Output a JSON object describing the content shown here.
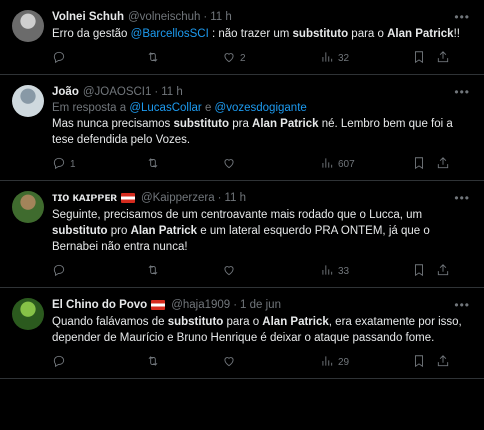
{
  "tweets": [
    {
      "name": "Volnei Schuh",
      "handle": "@volneischuh",
      "dot": "·",
      "time": "11 h",
      "flag": false,
      "reply_to": null,
      "segments": [
        {
          "t": "Erro da gestão ",
          "s": "n"
        },
        {
          "t": "@BarcellosSCI",
          "s": "l"
        },
        {
          "t": " : não trazer um ",
          "s": "n"
        },
        {
          "t": "substituto",
          "s": "b"
        },
        {
          "t": " para o ",
          "s": "n"
        },
        {
          "t": "Alan Patrick",
          "s": "b"
        },
        {
          "t": "!!",
          "s": "n"
        }
      ],
      "replies": "",
      "retweets": "",
      "likes": "2",
      "views": "32",
      "avatar_colors": [
        "#6b6b6b",
        "#cfcfcf"
      ]
    },
    {
      "name": "João",
      "handle": "@JOAOSCI1",
      "dot": "·",
      "time": "11 h",
      "flag": false,
      "reply_to": {
        "prefix": "Em resposta a ",
        "user1": "@LucasCollar",
        "joiner": " e ",
        "user2": "@vozesdogigante"
      },
      "segments": [
        {
          "t": "Mas nunca precisamos ",
          "s": "n"
        },
        {
          "t": "substituto",
          "s": "b"
        },
        {
          "t": " pra ",
          "s": "n"
        },
        {
          "t": "Alan Patrick",
          "s": "b"
        },
        {
          "t": " né. Lembro bem que foi a tese defendida pelo Vozes.",
          "s": "n"
        }
      ],
      "replies": "1",
      "retweets": "",
      "likes": "",
      "views": "607",
      "avatar_colors": [
        "#cfd9de",
        "#8899a6"
      ]
    },
    {
      "name": "ᴛɪᴏ ᴋᴀɪᴘᴘᴇʀ",
      "handle": "@Kaipperzera",
      "dot": "·",
      "time": "11 h",
      "flag": true,
      "reply_to": null,
      "segments": [
        {
          "t": "Seguinte, precisamos de um centroavante mais rodado que o Lucca, um ",
          "s": "n"
        },
        {
          "t": "substituto",
          "s": "b"
        },
        {
          "t": " pro ",
          "s": "n"
        },
        {
          "t": "Alan Patrick",
          "s": "b"
        },
        {
          "t": " e um lateral esquerdo PRA ONTEM, já que o Bernabei não entra nunca!",
          "s": "n"
        }
      ],
      "replies": "",
      "retweets": "",
      "likes": "",
      "views": "33",
      "avatar_colors": [
        "#3f6b2e",
        "#a3845a"
      ]
    },
    {
      "name": "El Chino do Povo",
      "handle": "@haja1909",
      "dot": "·",
      "time": "1 de jun",
      "flag": true,
      "reply_to": null,
      "segments": [
        {
          "t": "Quando falávamos de ",
          "s": "n"
        },
        {
          "t": "substituto",
          "s": "b"
        },
        {
          "t": " para o ",
          "s": "n"
        },
        {
          "t": "Alan Patrick",
          "s": "b"
        },
        {
          "t": ", era exatamente por isso, depender de Maurício e Bruno Henrique é deixar o ataque passando fome.",
          "s": "n"
        }
      ],
      "replies": "",
      "retweets": "",
      "likes": "",
      "views": "29",
      "avatar_colors": [
        "#2b5a1e",
        "#86c247"
      ]
    }
  ],
  "colors": {
    "background": "#000000",
    "text": "#e7e9ea",
    "muted": "#71767b",
    "link": "#1d9bf0",
    "border": "#2f3336"
  },
  "icons": {
    "more": "more-dots-icon",
    "reply": "reply-icon",
    "retweet": "retweet-icon",
    "like": "heart-icon",
    "views": "views-chart-icon",
    "bookmark": "bookmark-icon",
    "share": "share-icon"
  }
}
